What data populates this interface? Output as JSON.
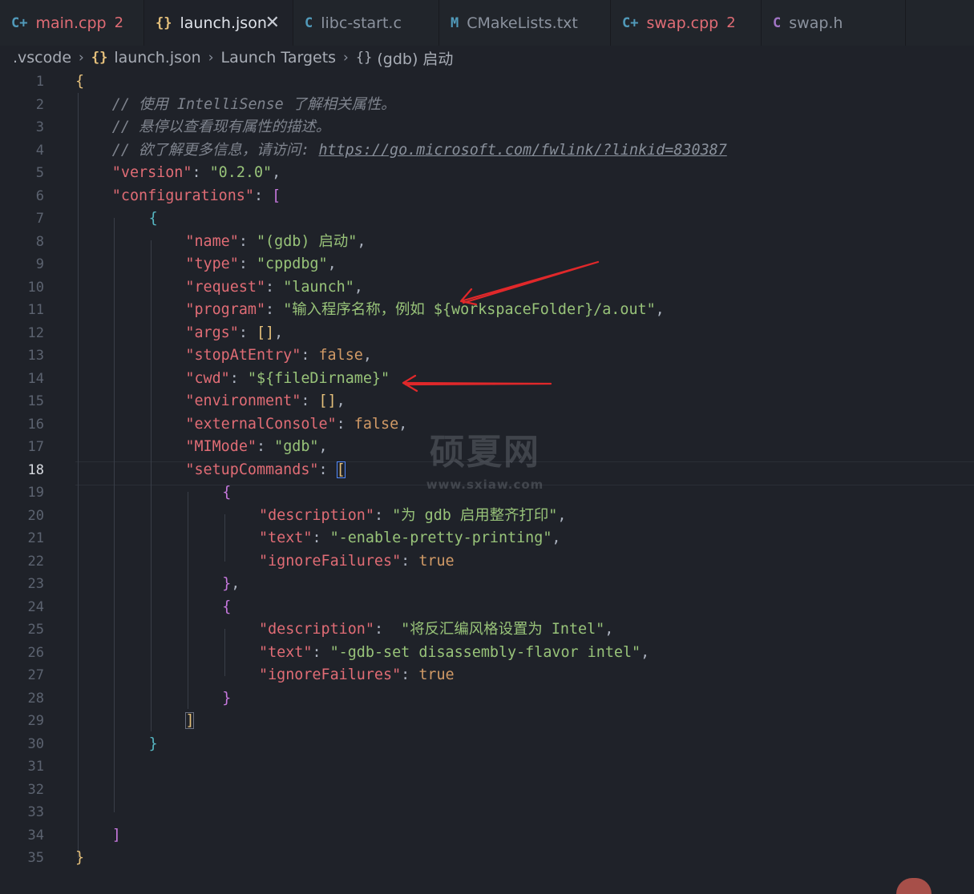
{
  "tabs": [
    {
      "label": "main.cpp",
      "icon": "C+",
      "icon_color": "#519aba",
      "label_color": "#e06c75",
      "badge": "2",
      "width": 180
    },
    {
      "label": "launch.json",
      "icon": "{}",
      "icon_color": "#e5c07b",
      "label_color": "#dfe3ea",
      "active": true,
      "close": "✕",
      "width": 186
    },
    {
      "label": "libc-start.c",
      "icon": "C",
      "icon_color": "#519aba",
      "label_color": "#8b929e",
      "width": 182
    },
    {
      "label": "CMakeLists.txt",
      "icon": "M",
      "icon_color": "#519aba",
      "label_color": "#8b929e",
      "width": 214
    },
    {
      "label": "swap.cpp",
      "icon": "C+",
      "icon_color": "#519aba",
      "label_color": "#e06c75",
      "badge": "2",
      "width": 188
    },
    {
      "label": "swap.h",
      "icon": "C",
      "icon_color": "#a074c4",
      "label_color": "#8b929e",
      "width": 180
    }
  ],
  "breadcrumb": {
    "folder": ".vscode",
    "file_icon": "{}",
    "file": "launch.json",
    "section": "Launch Targets",
    "item_icon": "{}",
    "item": "(gdb) 启动",
    "separator": "›"
  },
  "editor": {
    "current_line": 18,
    "lines": [
      [
        [
          "{",
          "br1"
        ]
      ],
      [
        [
          "// 使用 IntelliSense 了解相关属性。",
          "com"
        ]
      ],
      [
        [
          "// 悬停以查看现有属性的描述。",
          "com"
        ]
      ],
      [
        [
          "// 欲了解更多信息，请访问: ",
          "com"
        ],
        [
          "https://go.microsoft.com/fwlink/?linkid=830387",
          "link"
        ]
      ],
      [
        [
          "\"version\"",
          "key"
        ],
        [
          ": ",
          "pun"
        ],
        [
          "\"0.2.0\"",
          "str"
        ],
        [
          ",",
          "pun"
        ]
      ],
      [
        [
          "\"configurations\"",
          "key"
        ],
        [
          ": ",
          "pun"
        ],
        [
          "[",
          "br2"
        ]
      ],
      [
        [
          "{",
          "br3"
        ]
      ],
      [
        [
          "\"name\"",
          "key"
        ],
        [
          ": ",
          "pun"
        ],
        [
          "\"(gdb) 启动\"",
          "str"
        ],
        [
          ",",
          "pun"
        ]
      ],
      [
        [
          "\"type\"",
          "key"
        ],
        [
          ": ",
          "pun"
        ],
        [
          "\"cppdbg\"",
          "str"
        ],
        [
          ",",
          "pun"
        ]
      ],
      [
        [
          "\"request\"",
          "key"
        ],
        [
          ": ",
          "pun"
        ],
        [
          "\"launch\"",
          "str"
        ],
        [
          ",",
          "pun"
        ]
      ],
      [
        [
          "\"program\"",
          "key"
        ],
        [
          ": ",
          "pun"
        ],
        [
          "\"输入程序名称，例如 ${workspaceFolder}/a.out\"",
          "str"
        ],
        [
          ",",
          "pun"
        ]
      ],
      [
        [
          "\"args\"",
          "key"
        ],
        [
          ": ",
          "pun"
        ],
        [
          "[]",
          "br1"
        ],
        [
          ",",
          "pun"
        ]
      ],
      [
        [
          "\"stopAtEntry\"",
          "key"
        ],
        [
          ": ",
          "pun"
        ],
        [
          "false",
          "val"
        ],
        [
          ",",
          "pun"
        ]
      ],
      [
        [
          "\"cwd\"",
          "key"
        ],
        [
          ": ",
          "pun"
        ],
        [
          "\"${fileDirname}\"",
          "str"
        ]
      ],
      [
        [
          "\"environment\"",
          "key"
        ],
        [
          ": ",
          "pun"
        ],
        [
          "[]",
          "br1"
        ],
        [
          ",",
          "pun"
        ]
      ],
      [
        [
          "\"externalConsole\"",
          "key"
        ],
        [
          ": ",
          "pun"
        ],
        [
          "false",
          "val"
        ],
        [
          ",",
          "pun"
        ]
      ],
      [
        [
          "\"MIMode\"",
          "key"
        ],
        [
          ": ",
          "pun"
        ],
        [
          "\"gdb\"",
          "str"
        ],
        [
          ",",
          "pun"
        ]
      ],
      [
        [
          "\"setupCommands\"",
          "key"
        ],
        [
          ": ",
          "pun"
        ],
        [
          "[",
          "br1 cur"
        ]
      ],
      [
        [
          "{",
          "br2"
        ]
      ],
      [
        [
          "\"description\"",
          "key"
        ],
        [
          ": ",
          "pun"
        ],
        [
          "\"为 gdb 启用整齐打印\"",
          "str"
        ],
        [
          ",",
          "pun"
        ]
      ],
      [
        [
          "\"text\"",
          "key"
        ],
        [
          ": ",
          "pun"
        ],
        [
          "\"-enable-pretty-printing\"",
          "str"
        ],
        [
          ",",
          "pun"
        ]
      ],
      [
        [
          "\"ignoreFailures\"",
          "key"
        ],
        [
          ": ",
          "pun"
        ],
        [
          "true",
          "val"
        ]
      ],
      [
        [
          "}",
          "br2"
        ],
        [
          ",",
          "pun"
        ]
      ],
      [
        [
          "{",
          "br2"
        ]
      ],
      [
        [
          "\"description\"",
          "key"
        ],
        [
          ":  ",
          "pun"
        ],
        [
          "\"将反汇编风格设置为 Intel\"",
          "str"
        ],
        [
          ",",
          "pun"
        ]
      ],
      [
        [
          "\"text\"",
          "key"
        ],
        [
          ": ",
          "pun"
        ],
        [
          "\"-gdb-set disassembly-flavor intel\"",
          "str"
        ],
        [
          ",",
          "pun"
        ]
      ],
      [
        [
          "\"ignoreFailures\"",
          "key"
        ],
        [
          ": ",
          "pun"
        ],
        [
          "true",
          "val"
        ]
      ],
      [
        [
          "}",
          "br2"
        ]
      ],
      [
        [
          "]",
          "br1 match"
        ]
      ],
      [
        [
          "}",
          "br3"
        ]
      ],
      [],
      [],
      [],
      [
        [
          "]",
          "br2"
        ]
      ],
      [
        [
          "}",
          "br1"
        ]
      ]
    ]
  },
  "watermark": {
    "title": "硕夏网",
    "url": "www.sxiaw.com"
  }
}
